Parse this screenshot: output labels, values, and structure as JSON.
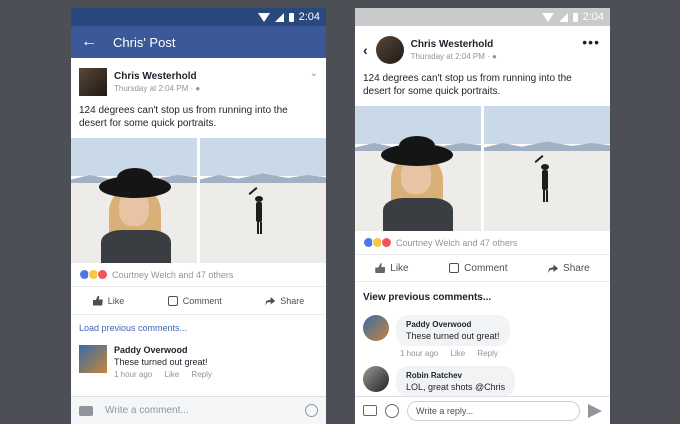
{
  "left": {
    "status_time": "2:04",
    "appbar_title": "Chris' Post",
    "post": {
      "author": "Chris Westerhold",
      "timestamp": "Thursday at 2:04 PM · ",
      "caption": "124 degrees can't stop us from running into the desert for some quick portraits.",
      "reaction_text": "Courtney Welch and 47 others"
    },
    "actions": {
      "like": "Like",
      "comment": "Comment",
      "share": "Share"
    },
    "load_previous": "Load previous comments...",
    "comment": {
      "author": "Paddy Overwood",
      "text": "These turned out great!",
      "time": "1 hour ago",
      "like": "Like",
      "reply": "Reply"
    },
    "composer_placeholder": "Write a comment..."
  },
  "right": {
    "status_time": "2:04",
    "post": {
      "author": "Chris Westerhold",
      "timestamp": "Thursday at 2:04 PM · ",
      "caption": "124 degrees can't stop us from running into the desert for some quick portraits.",
      "reaction_text": "Courtney Welch and 47 others"
    },
    "actions": {
      "like": "Like",
      "comment": "Comment",
      "share": "Share"
    },
    "view_previous": "View previous comments...",
    "comments": [
      {
        "author": "Paddy Overwood",
        "text": "These turned out great!",
        "time": "1 hour ago",
        "like": "Like",
        "reply": "Reply"
      },
      {
        "author": "Robin Ratchev",
        "text": "LOL, great shots @Chris"
      }
    ],
    "composer_placeholder": "Write a reply..."
  },
  "colors": {
    "fb_blue": "#3b5998",
    "fb_dark_blue": "#29487d",
    "link": "#4267b2"
  }
}
